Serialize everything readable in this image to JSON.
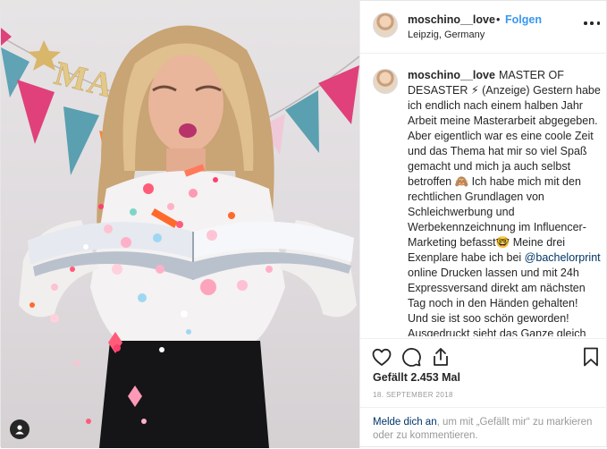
{
  "post": {
    "username": "moschino__love",
    "separator": "•",
    "follow_label": "Folgen",
    "location": "Leipzig, Germany",
    "caption": {
      "username": "moschino__love",
      "text_before_mention": "MASTER OF DESASTER ⚡ (Anzeige) Gestern habe ich endlich nach einem halben Jahr Arbeit meine Masterarbeit abgegeben. Aber eigentlich war es eine coole Zeit und das Thema hat mir so viel Spaß gemacht und mich ja auch selbst betroffen 🙈 Ich habe mich mit den rechtlichen Grundlagen von Schleichwerbung und Werbekennzeichnung im Influencer-Marketing befasst🤓 Meine drei Exenplare habe ich bei",
      "mention": "@bachelorprint",
      "text_after_mention": "online Drucken lassen und mit 24h Expressversand direkt am nächsten Tag noch in den Händen gehalten! Und sie ist soo schön geworden! Ausgedruckt sieht das Ganze gleich nochmal viel professioneller und wertvoller aus! (Foto Inspo by"
    },
    "likes": "Gefällt 2.453 Mal",
    "date": "18. SEPTEMBER 2018",
    "login_link": "Melde dich an",
    "login_text": ", um mit „Gefällt mir“ zu markieren oder zu kommentieren."
  },
  "photo": {
    "banner_text": "MASTER",
    "icons": {
      "profile": "person-icon"
    }
  },
  "icons": {
    "more": "more-options-icon",
    "like": "heart-icon",
    "comment": "comment-icon",
    "share": "share-icon",
    "save": "bookmark-icon"
  },
  "colors": {
    "link": "#3897f0",
    "mention": "#003569",
    "muted": "#999999",
    "text": "#262626"
  }
}
